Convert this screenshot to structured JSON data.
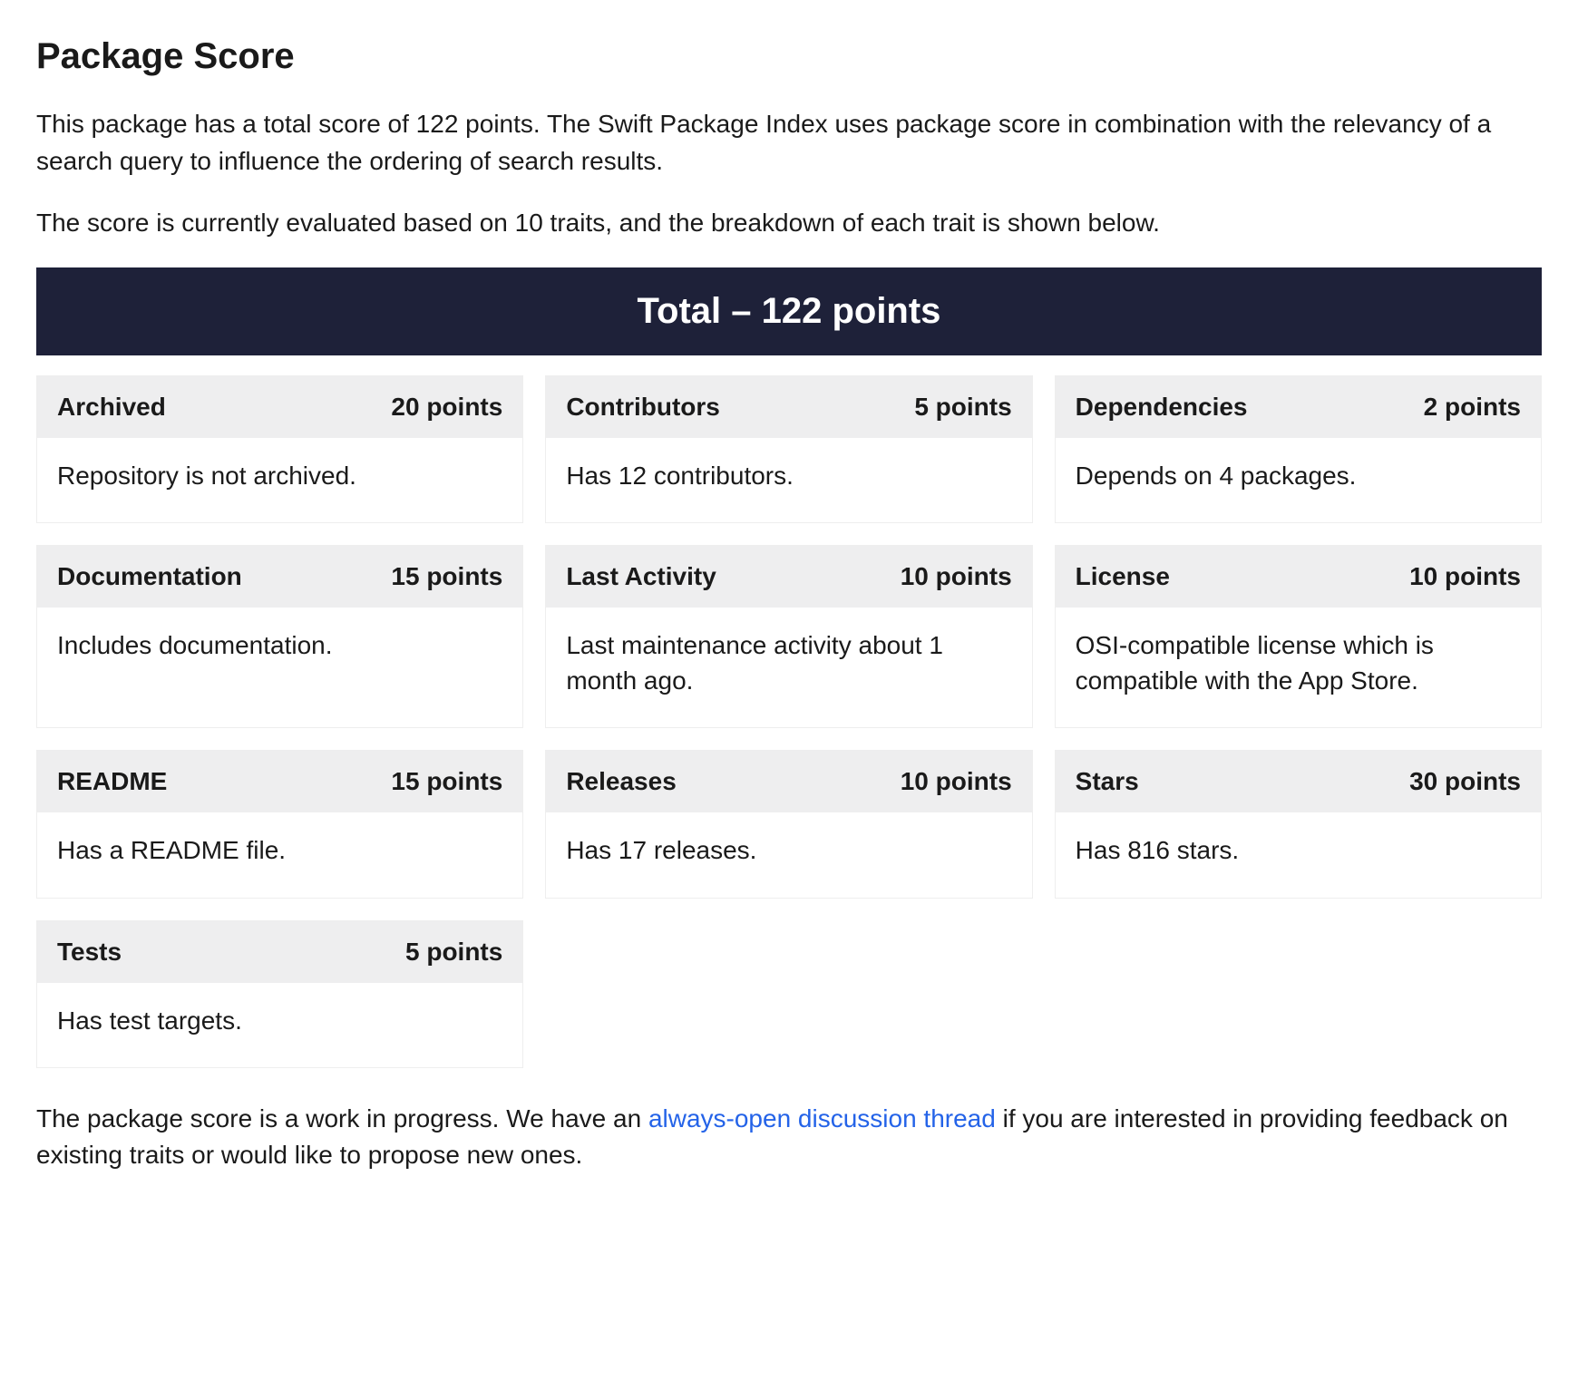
{
  "heading": "Package Score",
  "intro1": "This package has a total score of 122 points. The Swift Package Index uses package score in combination with the relevancy of a search query to influence the ordering of search results.",
  "intro2": "The score is currently evaluated based on 10 traits, and the breakdown of each trait is shown below.",
  "totalBanner": "Total – 122 points",
  "traits": [
    {
      "title": "Archived",
      "points": "20 points",
      "body": "Repository is not archived."
    },
    {
      "title": "Contributors",
      "points": "5 points",
      "body": "Has 12 contributors."
    },
    {
      "title": "Dependencies",
      "points": "2 points",
      "body": "Depends on 4 packages."
    },
    {
      "title": "Documentation",
      "points": "15 points",
      "body": "Includes documentation."
    },
    {
      "title": "Last Activity",
      "points": "10 points",
      "body": "Last maintenance activity about 1 month ago."
    },
    {
      "title": "License",
      "points": "10 points",
      "body": "OSI-compatible license which is compatible with the App Store."
    },
    {
      "title": "README",
      "points": "15 points",
      "body": "Has a README file."
    },
    {
      "title": "Releases",
      "points": "10 points",
      "body": "Has 17 releases."
    },
    {
      "title": "Stars",
      "points": "30 points",
      "body": "Has 816 stars."
    },
    {
      "title": "Tests",
      "points": "5 points",
      "body": "Has test targets."
    }
  ],
  "footer": {
    "prefix": "The package score is a work in progress. We have an ",
    "linkText": "always-open discussion thread",
    "suffix": " if you are interested in providing feedback on existing traits or would like to propose new ones."
  }
}
